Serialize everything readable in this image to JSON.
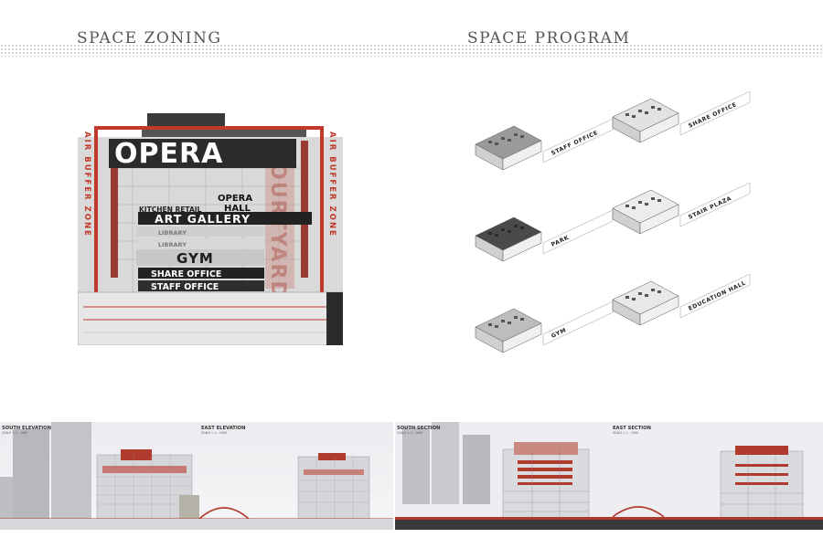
{
  "headers": {
    "left": "SPACE ZONING",
    "right": "SPACE PROGRAM"
  },
  "zoning": {
    "side_label": "AIR BUFFER ZONE",
    "side_label_left_top": "AIR",
    "side_label_left_mid": "BUFFER",
    "side_label_left_bot": "ZONE",
    "vertical_label": "COURTYARD",
    "opera": "OPERA",
    "opera_hall_1": "OPERA",
    "opera_hall_2": "HALL",
    "kitchen_retail": "KITCHEN RETAIL",
    "art_gallery": "ART GALLERY",
    "library_1": "LIBRARY",
    "library_2": "LIBRARY",
    "gym": "GYM",
    "share_office": "SHARE OFFICE",
    "staff_office": "STAFF OFFICE",
    "accent_color": "#c0392b"
  },
  "program": {
    "modules": [
      {
        "label": "STAFF OFFICE"
      },
      {
        "label": "SHARE OFFICE"
      },
      {
        "label": "PARK"
      },
      {
        "label": "STAIR PLAZA"
      },
      {
        "label": "GYM"
      },
      {
        "label": "EDUCATION HALL"
      }
    ]
  },
  "drawings": {
    "left_panel": {
      "title_a": "SOUTH ELEVATION",
      "sub_a": "SCALE = 1 : 1000",
      "title_b": "EAST ELEVATION",
      "sub_b": "SCALE = 1 : 1000"
    },
    "right_panel": {
      "title_a": "SOUTH SECTION",
      "sub_a": "SCALE = 1 : 1000",
      "title_b": "EAST SECTION",
      "sub_b": "SCALE = 1 : 1000"
    }
  }
}
